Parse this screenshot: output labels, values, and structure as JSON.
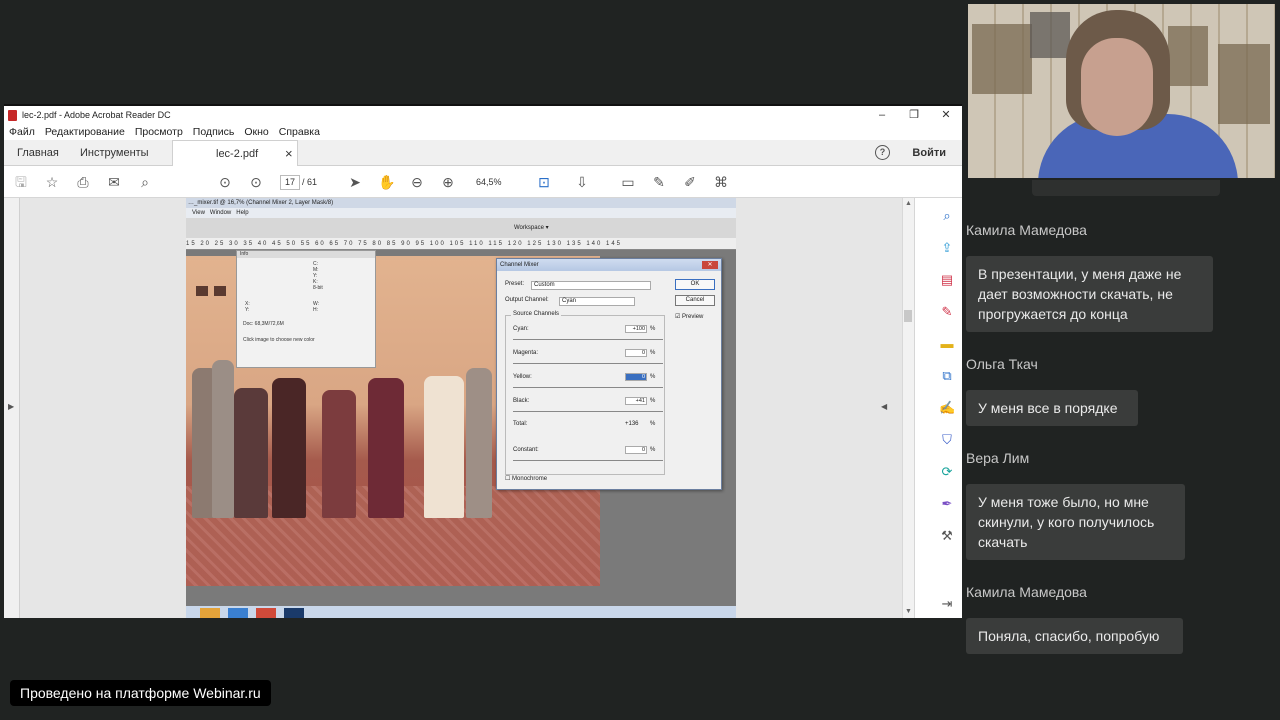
{
  "acrobat": {
    "window_title": "lec-2.pdf - Adobe Acrobat Reader DC",
    "window_controls": {
      "minimize": "–",
      "restore": "❐",
      "close": "✕"
    },
    "menu": [
      "Файл",
      "Редактирование",
      "Просмотр",
      "Подпись",
      "Окно",
      "Справка"
    ],
    "tabs": {
      "home": "Главная",
      "tools": "Инструменты",
      "document": "lec-2.pdf",
      "close": "×"
    },
    "help_label": "?",
    "signin_label": "Войти",
    "page_current": "17",
    "page_total": "/ 61",
    "zoom": "64,5%"
  },
  "photoshop": {
    "title": "…_mixer.tif @ 16,7% (Channel Mixer 2, Layer Mask/8)",
    "menu": [
      "View",
      "Window",
      "Help"
    ],
    "workspace_label": "Workspace ▾",
    "ruler": "15 20 25 30 35 40 45 50 55 60 65 70 75 80 85 90 95 100 105 110 115 120 125 130 135 140 145",
    "info_panel": {
      "title": "Info",
      "doc": "Doc: 68,3M/72,6M",
      "hint": "Click image to choose new color",
      "c": "C:",
      "m": "M:",
      "y": "Y:",
      "k": "K:",
      "bit": "8-bit",
      "x": "X:",
      "y2": "Y:",
      "w": "W:",
      "h": "H:"
    },
    "channel_mixer": {
      "title": "Channel Mixer",
      "ok": "OK",
      "cancel": "Cancel",
      "preset_label": "Preset:",
      "preset_value": "Custom",
      "output_label": "Output Channel:",
      "output_value": "Cyan",
      "preview_label": "Preview",
      "group_label": "Source Channels",
      "cyan_label": "Cyan:",
      "cyan_value": "+100",
      "magenta_label": "Magenta:",
      "magenta_value": "0",
      "yellow_label": "Yellow:",
      "yellow_value": "0",
      "black_label": "Black:",
      "black_value": "+41",
      "total_label": "Total:",
      "total_value": "+136",
      "constant_label": "Constant:",
      "constant_value": "0",
      "percent": "%",
      "monochrome_label": "Monochrome"
    }
  },
  "chat": {
    "messages": [
      {
        "author": "Камила Мамедова",
        "text": "В презентации, у меня даже не дает возможности скачать, не прогружается до конца"
      },
      {
        "author": "Ольга Ткач",
        "text": "У меня все в порядке"
      },
      {
        "author": "Вера Лим",
        "text": "У меня тоже было, но мне скинули, у кого получилось скачать"
      },
      {
        "author": "Камила Мамедова",
        "text": "Поняла, спасибо, попробую"
      }
    ]
  },
  "footer": {
    "text": "Проведено на платформе Webinar.ru"
  }
}
